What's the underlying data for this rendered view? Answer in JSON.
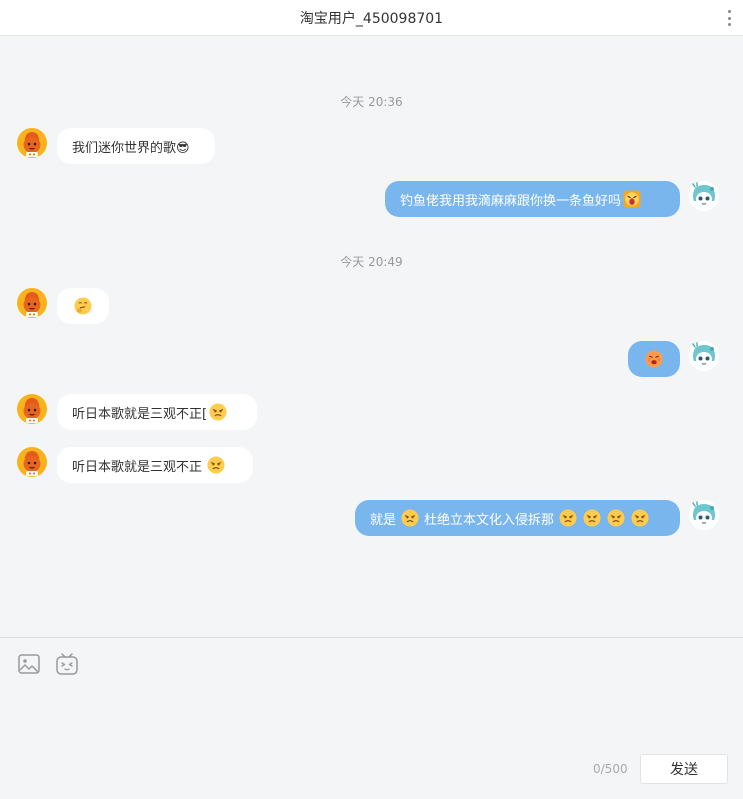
{
  "header": {
    "title": "淘宝用户_450098701"
  },
  "messages": {
    "ts1": "今天 20:36",
    "m1": "我们迷你世界的歌😎",
    "m2": "钓鱼佬我用我滴麻麻跟你换一条鱼好吗",
    "ts2": "今天 20:49",
    "m5a": "听日本歌就是三观不正[",
    "m6a": "听日本歌就是三观不正",
    "m7a": "就是",
    "m7b": "杜绝立本文化入侵拆那"
  },
  "composer": {
    "counter": "0/500",
    "send_label": "发送"
  },
  "icons": {
    "image": "image-icon",
    "emoji": "emoji-icon",
    "more": "more-vertical-icon"
  },
  "colors": {
    "outgoing_bubble": "#7ab6ee",
    "incoming_bubble": "#ffffff",
    "background": "#f4f5f7"
  }
}
